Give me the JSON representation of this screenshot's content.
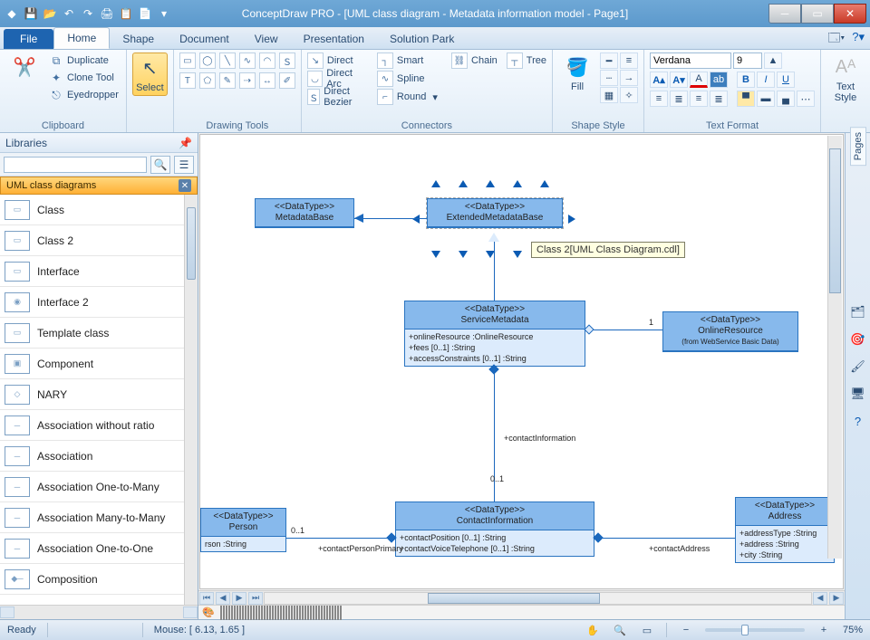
{
  "title": "ConceptDraw PRO - [UML class diagram - Metadata information model - Page1]",
  "tabs": {
    "file": "File",
    "items": [
      "Home",
      "Shape",
      "Document",
      "View",
      "Presentation",
      "Solution Park"
    ],
    "active": 0
  },
  "ribbon": {
    "clipboard": {
      "duplicate": "Duplicate",
      "clone": "Clone Tool",
      "eyedropper": "Eyedropper",
      "label": "Clipboard"
    },
    "select": {
      "label": "Select"
    },
    "drawing": {
      "label": "Drawing Tools"
    },
    "connectors": {
      "items": [
        [
          "Direct",
          "Smart",
          "Chain"
        ],
        [
          "Direct Arc",
          "Spline",
          "Tree"
        ],
        [
          "Direct Bezier",
          "Round",
          ""
        ]
      ],
      "label": "Connectors"
    },
    "fill": "Fill",
    "shapestyle": "Shape Style",
    "textformat": {
      "font": "Verdana",
      "size": "9",
      "label": "Text Format"
    },
    "textstyle": "Text\nStyle"
  },
  "sidebar": {
    "title": "Libraries",
    "category": "UML class diagrams",
    "items": [
      "Class",
      "Class 2",
      "Interface",
      "Interface 2",
      "Template class",
      "Component",
      "NARY",
      "Association without ratio",
      "Association",
      "Association One-to-Many",
      "Association Many-to-Many",
      "Association One-to-One",
      "Composition"
    ]
  },
  "canvas": {
    "box_metadatabase": {
      "stereo": "<<DataType>>",
      "name": "MetadataBase"
    },
    "box_ext": {
      "stereo": "<<DataType>>",
      "name": "ExtendedMetadataBase"
    },
    "box_service": {
      "stereo": "<<DataType>>",
      "name": "ServiceMetadata",
      "attrs": [
        "+onlineResource :OnlineResource",
        "+fees [0..1] :String",
        "+accessConstraints [0..1] :String"
      ]
    },
    "box_online": {
      "stereo": "<<DataType>>",
      "name": "OnlineResource",
      "from": "(from WebService Basic Data)"
    },
    "box_contact": {
      "stereo": "<<DataType>>",
      "name": "ContactInformation",
      "attrs": [
        "+contactPosition [0..1] :String",
        "+contactVoiceTelephone [0..1] :String"
      ]
    },
    "box_person": {
      "stereo": "<<DataType>>",
      "name": "Person",
      "attrs": [
        "rson :String"
      ]
    },
    "box_address": {
      "stereo": "<<DataType>>",
      "name": "Address",
      "attrs": [
        "+addressType :String",
        "+address :String",
        "+city :String"
      ]
    },
    "tooltip": "Class 2[UML Class Diagram.cdl]",
    "lbl_contactinfo": "+contactInformation",
    "lbl_card01a": "0..1",
    "lbl_person_role": "+contactPersonPrimary",
    "lbl_card01b": "0..1",
    "lbl_address_role": "+contactAddress",
    "lbl_one": "1"
  },
  "colors": [
    "#000000",
    "#7f7f7f",
    "#c0c0c0",
    "#ffffff",
    "#800000",
    "#ff0000",
    "#ff6a00",
    "#ffaa00",
    "#ffd800",
    "#ffff00",
    "#b6ff00",
    "#4cff00",
    "#00ff21",
    "#00ff90",
    "#00ffff",
    "#00c8ff",
    "#0094ff",
    "#0026ff",
    "#4800ff",
    "#b200ff",
    "#ff00dc",
    "#ff006e",
    "#5c3a21",
    "#8b5a2b",
    "#a0522d",
    "#cd853f",
    "#d2b48c",
    "#556b2f",
    "#6b8e23",
    "#2e8b57",
    "#008080",
    "#4682b4",
    "#1e90ff",
    "#483d8b",
    "#6a5acd",
    "#8a2be2",
    "#9932cc",
    "#c71585",
    "#db7093",
    "#f08080",
    "#e9967a",
    "#fa8072",
    "#ffa07a",
    "#ffb6c1",
    "#ffe4e1"
  ],
  "status": {
    "ready": "Ready",
    "mouse": "Mouse: [ 6.13, 1.65 ]",
    "zoom": "75%"
  },
  "rightdock": {
    "pages": "Pages"
  }
}
